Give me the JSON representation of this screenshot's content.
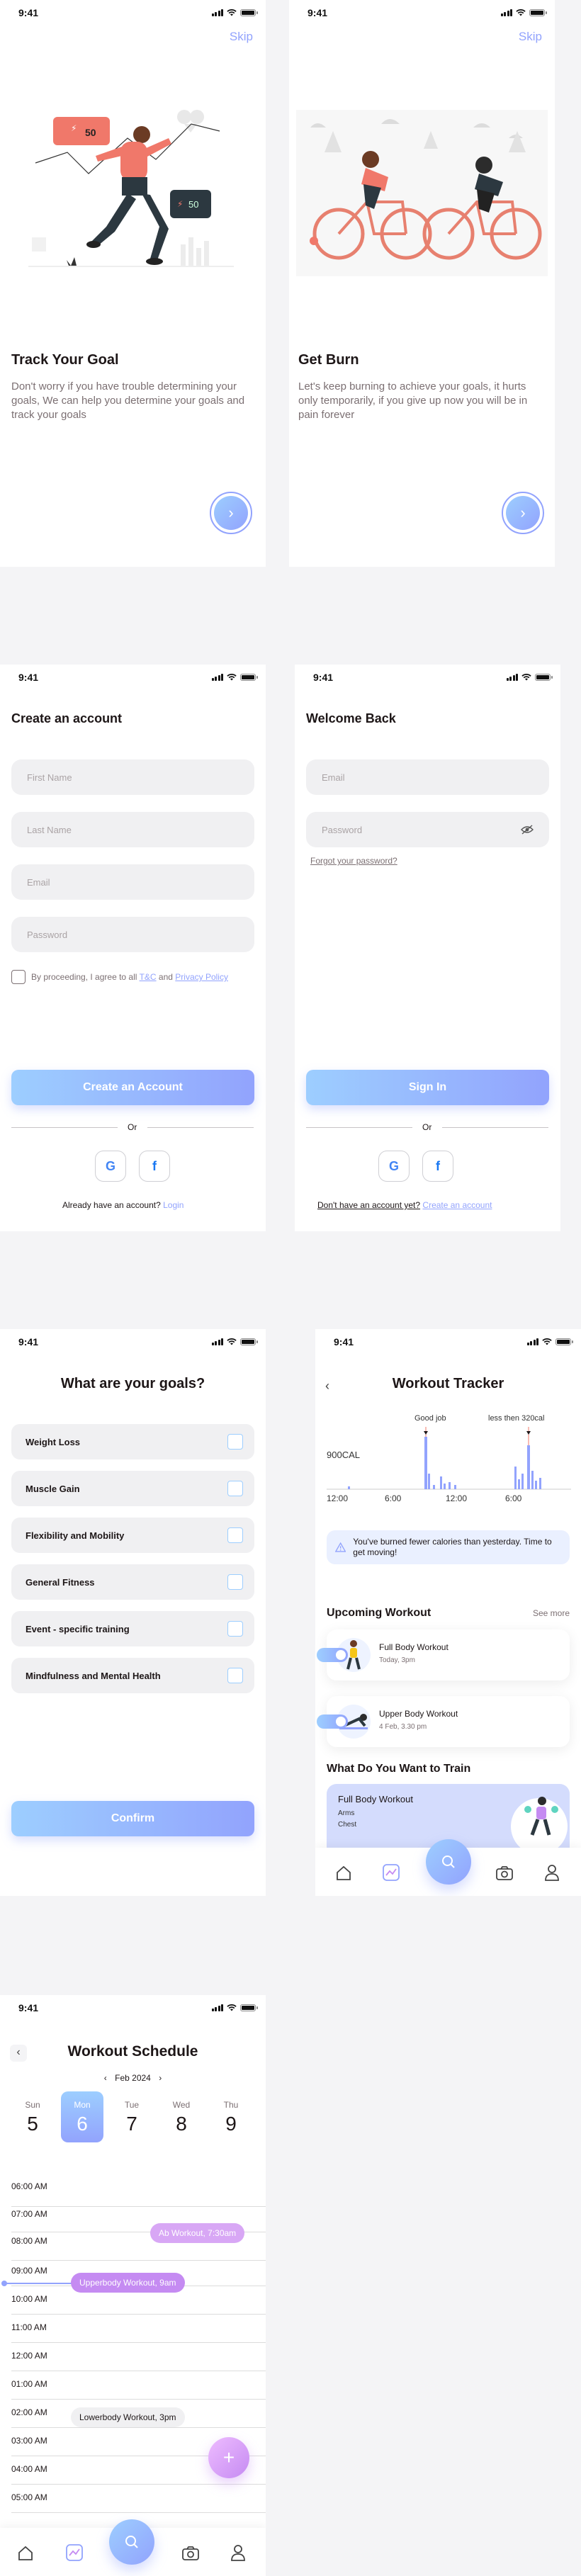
{
  "status_time": "9:41",
  "onboarding1": {
    "skip": "Skip",
    "title": "Track Your Goal",
    "desc": "Don't worry if you have trouble determining your goals, We can help you determine your goals and track your goals",
    "badge1": "50",
    "badge2": "50"
  },
  "onboarding2": {
    "skip": "Skip",
    "title": "Get Burn",
    "desc": "Let's keep burning to achieve your goals, it hurts only temporarily, if you give up now you will be in pain forever"
  },
  "register": {
    "title": "Create an account",
    "first_name": "First Name",
    "last_name": "Last Name",
    "email": "Email",
    "password": "Password",
    "terms_prefix": "By proceeding, I agree to all",
    "terms_tc": "T&C",
    "terms_and": "and",
    "terms_privacy": "Privacy Policy",
    "create_btn": "Create an Account",
    "or": "Or",
    "have_account": "Already have an account?",
    "login_link": "Login"
  },
  "login": {
    "title": "Welcome Back",
    "email": "Email",
    "password": "Password",
    "forgot": "Forgot your password?",
    "signin_btn": "Sign In",
    "or": "Or",
    "no_account": "Don't have an account yet?",
    "create_link": "Create an account"
  },
  "goals": {
    "title": "What are your goals?",
    "items": [
      "Weight Loss",
      "Muscle Gain",
      "Flexibility and Mobility",
      "General Fitness",
      "Event - specific training",
      "Mindfulness and Mental Health"
    ],
    "confirm": "Confirm"
  },
  "tracker": {
    "title": "Workout Tracker",
    "y_label": "900CAL",
    "ann_good": "Good job",
    "ann_less": "less then 320cal",
    "x_ticks": [
      "12:00",
      "6:00",
      "12:00",
      "6:00"
    ],
    "alert": "You've burned fewer calories than yesterday. Time to get moving!",
    "upcoming_title": "Upcoming Workout",
    "see_more": "See more",
    "workouts": [
      {
        "name": "Full Body Workout",
        "time": "Today, 3pm"
      },
      {
        "name": "Upper Body Workout",
        "time": "4 Feb, 3.30 pm"
      }
    ],
    "train_title": "What Do You Want to Train",
    "train_card_title": "Full Body Workout",
    "train_card_items": [
      "Arms",
      "Chest"
    ]
  },
  "schedule": {
    "title": "Workout Schedule",
    "month": "Feb 2024",
    "days": [
      {
        "name": "Sun",
        "date": "5"
      },
      {
        "name": "Mon",
        "date": "6"
      },
      {
        "name": "Tue",
        "date": "7"
      },
      {
        "name": "Wed",
        "date": "8"
      },
      {
        "name": "Thu",
        "date": "9"
      }
    ],
    "hours": [
      "06:00 AM",
      "07:00 AM",
      "08:00 AM",
      "09:00 AM",
      "10:00 AM",
      "11:00 AM",
      "12:00 AM",
      "01:00 AM",
      "02:00 AM",
      "03:00 AM",
      "04:00 AM",
      "05:00 AM"
    ],
    "events": [
      "Ab Workout, 7:30am",
      "Upperbody Workout, 9am",
      "Lowerbody Workout, 3pm"
    ]
  },
  "colors": {
    "brand_blue": "#92a3fd",
    "brand_light": "#9dceff",
    "purple": "#c58bf2",
    "text": "#1d1617",
    "gray": "#7b6f72"
  }
}
